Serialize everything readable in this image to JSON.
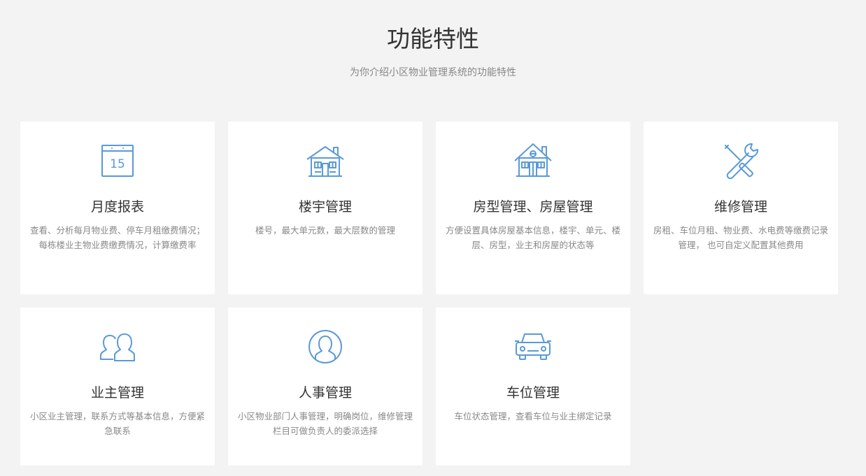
{
  "header": {
    "title": "功能特性",
    "subtitle": "为你介绍小区物业管理系统的功能特性"
  },
  "accent_color": "#5a9ad6",
  "features": [
    {
      "icon": "calendar-icon",
      "calendar_day": "15",
      "title": "月度报表",
      "desc": "查看、分析每月物业费、停车月租缴费情况；每栋楼业主物业费缴费情况，计算缴费率"
    },
    {
      "icon": "building-icon",
      "title": "楼宇管理",
      "desc": "楼号，最大单元数，最大层数的管理"
    },
    {
      "icon": "house-icon",
      "title": "房型管理、房屋管理",
      "desc": "方便设置具体房屋基本信息，楼宇、单元、楼层、房型，业主和房屋的状态等"
    },
    {
      "icon": "tools-icon",
      "title": "维修管理",
      "desc": "房租、车位月租、物业费、水电费等缴费记录管理， 也可自定义配置其他费用"
    },
    {
      "icon": "users-icon",
      "title": "业主管理",
      "desc": "小区业主管理，联系方式等基本信息，方便紧急联系"
    },
    {
      "icon": "person-icon",
      "title": "人事管理",
      "desc": "小区物业部门人事管理，明确岗位，维修管理栏目可做负责人的委派选择"
    },
    {
      "icon": "car-icon",
      "title": "车位管理",
      "desc": "车位状态管理，查看车位与业主绑定记录"
    }
  ]
}
